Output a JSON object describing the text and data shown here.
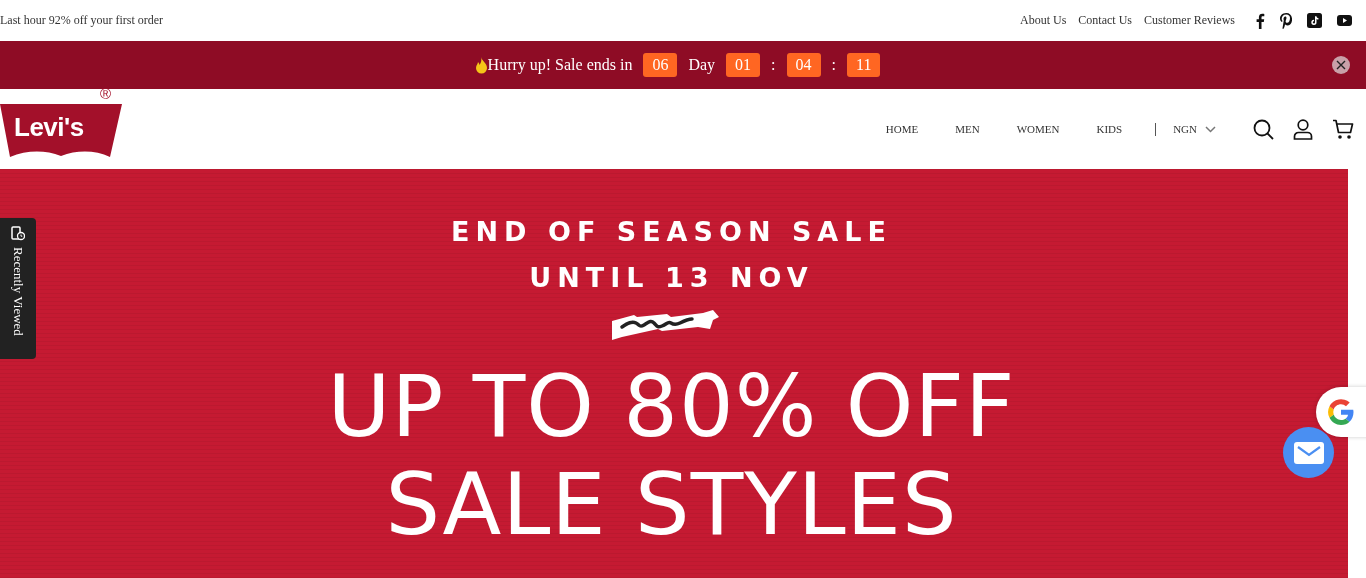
{
  "top_bar": {
    "promo": "Last hour 92% off your first order",
    "links": [
      "About Us",
      "Contact Us",
      "Customer Reviews"
    ],
    "social": [
      {
        "kind": "facebook"
      },
      {
        "kind": "pinterest"
      },
      {
        "kind": "tiktok"
      },
      {
        "kind": "youtube"
      }
    ]
  },
  "countdown_bar": {
    "message": "Hurry up! Sale ends in",
    "items": [
      {
        "kind": "box",
        "text": "06"
      },
      {
        "kind": "label",
        "text": "Day"
      },
      {
        "kind": "box",
        "text": "01"
      },
      {
        "kind": "label",
        "text": ":"
      },
      {
        "kind": "box",
        "text": "04"
      },
      {
        "kind": "label",
        "text": ":"
      },
      {
        "kind": "box",
        "text": "11"
      }
    ]
  },
  "header": {
    "logo": {
      "text": "Levi's",
      "mark": "®"
    },
    "nav": [
      "HOME",
      "MEN",
      "WOMEN",
      "KIDS"
    ],
    "currency": "NGN"
  },
  "hero": {
    "lines": [
      {
        "kind": "heading",
        "text": "END OF SEASON SALE"
      },
      {
        "kind": "heading",
        "text": "UNTIL 13 NOV"
      },
      {
        "kind": "squiggle"
      },
      {
        "kind": "headline",
        "text": "UP TO 80% OFF"
      },
      {
        "kind": "headline",
        "text": "SALE STYLES"
      }
    ]
  },
  "recently_viewed": {
    "label": "Recently Viewed"
  }
}
